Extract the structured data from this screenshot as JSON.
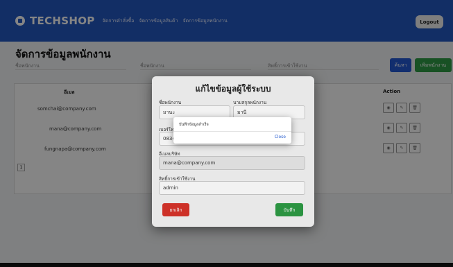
{
  "navbar": {
    "brand": "TECHSHOP",
    "links": [
      "จัดการคำสั่งซื้อ",
      "จัดการข้อมูลสินค้า",
      "จัดการข้อมูลพนักงาน"
    ],
    "logout_label": "Logout"
  },
  "page": {
    "title": "จัดการข้อมูลพนักงาน",
    "filters": [
      "ชื่อพนักงาน",
      "ชื่อพนักงาน",
      "สิทธิ์การเข้าใช้งาน"
    ],
    "search_label": "ค้นหา",
    "add_label": "เพิ่มพนักงาน"
  },
  "table": {
    "headers": [
      "อีเมล",
      "Action"
    ],
    "rows": [
      {
        "email": "somchai@company.com"
      },
      {
        "email": "mana@company.com"
      },
      {
        "email": "fungnapa@company.com"
      }
    ],
    "action_icons": [
      "eye-icon",
      "pencil-icon",
      "trash-icon"
    ],
    "page_number": "1"
  },
  "modal": {
    "title": "แก้ไขข้อมูลผู้ใช้ระบบ",
    "first_name_label": "ชื่อพนักงาน",
    "first_name_value": "มานะ",
    "last_name_label": "นามสกุลพนักงาน",
    "last_name_value": "มานี",
    "phone_label": "เบอร์โทร",
    "phone_value": "0834",
    "email_label": "อีเมลบริษัท",
    "email_value": "mana@company.com",
    "role_label": "สิทธิ์การเข้าใช้งาน",
    "role_value": "admin",
    "cancel_label": "ยกเลิก",
    "save_label": "บันทึก"
  },
  "alert": {
    "message": "บันทึกข้อมูลสำเร็จ",
    "close_label": "Close"
  },
  "colors": {
    "navbar": "#2459c2",
    "search": "#2458d4",
    "success": "#2e9b45",
    "danger": "#d9342b",
    "link": "#2a5fcf"
  }
}
